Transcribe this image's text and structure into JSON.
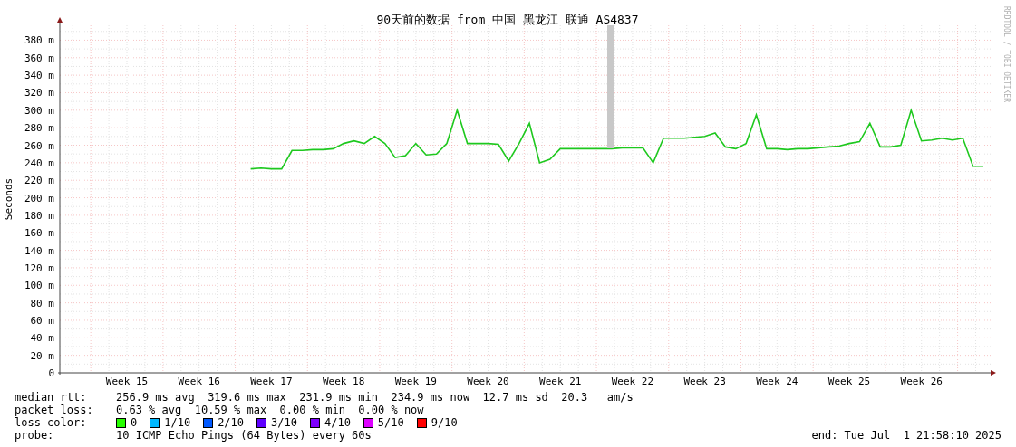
{
  "chart": {
    "side_note": "RRDTOOL / TOBI OETIKER",
    "chart_data": {
      "type": "line",
      "title": "90天前的数据 from 中国 黑龙江 联通 AS4837",
      "ylabel": "Seconds",
      "categories": [
        null,
        null,
        null,
        null,
        null,
        null,
        "Week 15",
        null,
        null,
        null,
        null,
        null,
        null,
        "Week 16",
        null,
        null,
        null,
        null,
        null,
        null,
        "Week 17",
        null,
        null,
        null,
        null,
        null,
        null,
        "Week 18",
        null,
        null,
        null,
        null,
        null,
        null,
        "Week 19",
        null,
        null,
        null,
        null,
        null,
        null,
        "Week 20",
        null,
        null,
        null,
        null,
        null,
        null,
        "Week 21",
        null,
        null,
        null,
        null,
        null,
        null,
        "Week 22",
        null,
        null,
        null,
        null,
        null,
        null,
        "Week 23",
        null,
        null,
        null,
        null,
        null,
        null,
        "Week 24",
        null,
        null,
        null,
        null,
        null,
        null,
        "Week 25",
        null,
        null,
        null,
        null,
        null,
        null,
        "Week 26",
        null,
        null,
        null,
        null,
        null,
        null
      ],
      "series": [
        {
          "color": "#1ec81e",
          "values": [
            null,
            null,
            null,
            null,
            null,
            null,
            null,
            null,
            null,
            null,
            null,
            null,
            null,
            null,
            null,
            null,
            null,
            null,
            233,
            234,
            233,
            233,
            254,
            254,
            255,
            255,
            256,
            262,
            265,
            262,
            270,
            262,
            246,
            248,
            262,
            249,
            250,
            262,
            300,
            262,
            262,
            262,
            261,
            242,
            262,
            285,
            240,
            244,
            256,
            256,
            256,
            256,
            256,
            256,
            257,
            257,
            257,
            240,
            268,
            268,
            268,
            269,
            270,
            274,
            258,
            256,
            262,
            295,
            256,
            256,
            255,
            256,
            256,
            257,
            258,
            259,
            262,
            264,
            285,
            258,
            258,
            260,
            300,
            265,
            266,
            268,
            266,
            268,
            236,
            236
          ]
        }
      ],
      "ylim": [
        0,
        397
      ],
      "yticks": [
        {
          "value": 0,
          "label": "0"
        },
        {
          "value": 20,
          "label": "20 m"
        },
        {
          "value": 40,
          "label": "40 m"
        },
        {
          "value": 60,
          "label": "60 m"
        },
        {
          "value": 80,
          "label": "80 m"
        },
        {
          "value": 100,
          "label": "100 m"
        },
        {
          "value": 120,
          "label": "120 m"
        },
        {
          "value": 140,
          "label": "140 m"
        },
        {
          "value": 160,
          "label": "160 m"
        },
        {
          "value": 180,
          "label": "180 m"
        },
        {
          "value": 200,
          "label": "200 m"
        },
        {
          "value": 220,
          "label": "220 m"
        },
        {
          "value": 240,
          "label": "240 m"
        },
        {
          "value": 260,
          "label": "260 m"
        },
        {
          "value": 280,
          "label": "280 m"
        },
        {
          "value": 300,
          "label": "300 m"
        },
        {
          "value": 320,
          "label": "320 m"
        },
        {
          "value": 340,
          "label": "340 m"
        },
        {
          "value": 360,
          "label": "360 m"
        },
        {
          "value": 380,
          "label": "380 m"
        }
      ],
      "grid": true
    }
  },
  "legend": {
    "rows": [
      {
        "label": "median rtt:",
        "text": "256.9 ms avg  319.6 ms max  231.9 ms min  234.9 ms now  12.7 ms sd  20.3   am/s"
      },
      {
        "label": "packet loss:",
        "text": "0.63 % avg  10.59 % max  0.00 % min  0.00 % now"
      }
    ],
    "loss_color": {
      "label": "loss color:",
      "items": [
        {
          "label": "0",
          "color": "#26ff00"
        },
        {
          "label": "1/10",
          "color": "#00b8ff"
        },
        {
          "label": "2/10",
          "color": "#0059ff"
        },
        {
          "label": "3/10",
          "color": "#5e00ff"
        },
        {
          "label": "4/10",
          "color": "#7e00ff"
        },
        {
          "label": "5/10",
          "color": "#dd00ff"
        },
        {
          "label": "9/10",
          "color": "#ff0000"
        }
      ]
    },
    "probe": {
      "label": "probe:",
      "text": "10 ICMP Echo Pings (64 Bytes) every 60s"
    },
    "end": "end: Tue Jul  1 21:58:10 2025"
  }
}
